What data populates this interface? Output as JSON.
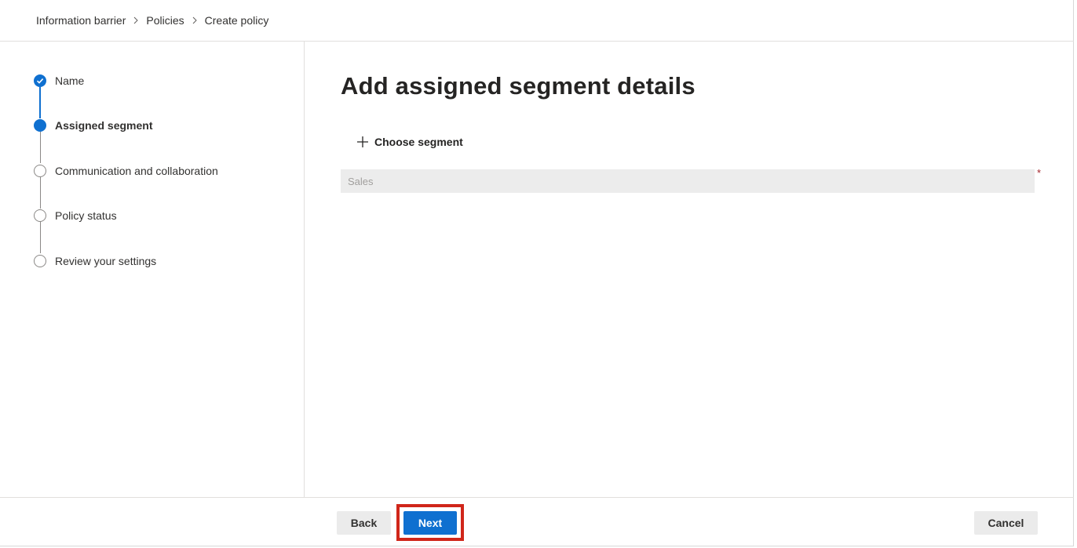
{
  "breadcrumb": {
    "items": [
      "Information barrier",
      "Policies",
      "Create policy"
    ]
  },
  "stepper": {
    "steps": [
      {
        "label": "Name",
        "state": "completed"
      },
      {
        "label": "Assigned segment",
        "state": "current"
      },
      {
        "label": "Communication and collaboration",
        "state": "pending"
      },
      {
        "label": "Policy status",
        "state": "pending"
      },
      {
        "label": "Review your settings",
        "state": "pending"
      }
    ]
  },
  "main": {
    "title": "Add assigned segment details",
    "choose_segment_label": "Choose segment",
    "segment_field": {
      "value": "Sales",
      "required_mark": "*"
    }
  },
  "footer": {
    "back_label": "Back",
    "next_label": "Next",
    "cancel_label": "Cancel"
  },
  "icons": {
    "completed-step": "checkmark-icon",
    "choose-segment": "plus-icon",
    "breadcrumb-separator": "chevron-right-icon"
  },
  "colors": {
    "accent": "#0f70d0",
    "highlight": "#d0261a",
    "required": "#a4262c"
  }
}
